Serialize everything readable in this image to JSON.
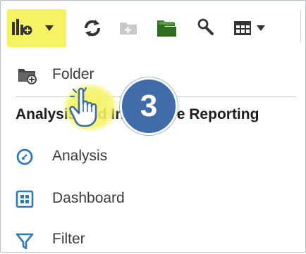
{
  "colors": {
    "highlight": "#f5f263",
    "icon_dark": "#333333",
    "icon_green": "#2e6e1e",
    "icon_gray": "#bdbdbd",
    "accent_blue": "#3f6ba8"
  },
  "toolbar": {
    "items": [
      {
        "icon": "new-content-icon"
      },
      {
        "icon": "refresh-icon"
      },
      {
        "icon": "folder-add-disabled-icon"
      },
      {
        "icon": "folder-open-icon"
      },
      {
        "icon": "search-icon"
      },
      {
        "icon": "view-options-icon"
      }
    ]
  },
  "menu": {
    "folder_label": "Folder",
    "section_header": "Analysis and Interactive Reporting",
    "items": [
      {
        "label": "Analysis",
        "icon": "analysis-icon"
      },
      {
        "label": "Dashboard",
        "icon": "dashboard-icon"
      },
      {
        "label": "Filter",
        "icon": "filter-icon"
      }
    ]
  },
  "callout": {
    "step_number": "3"
  }
}
